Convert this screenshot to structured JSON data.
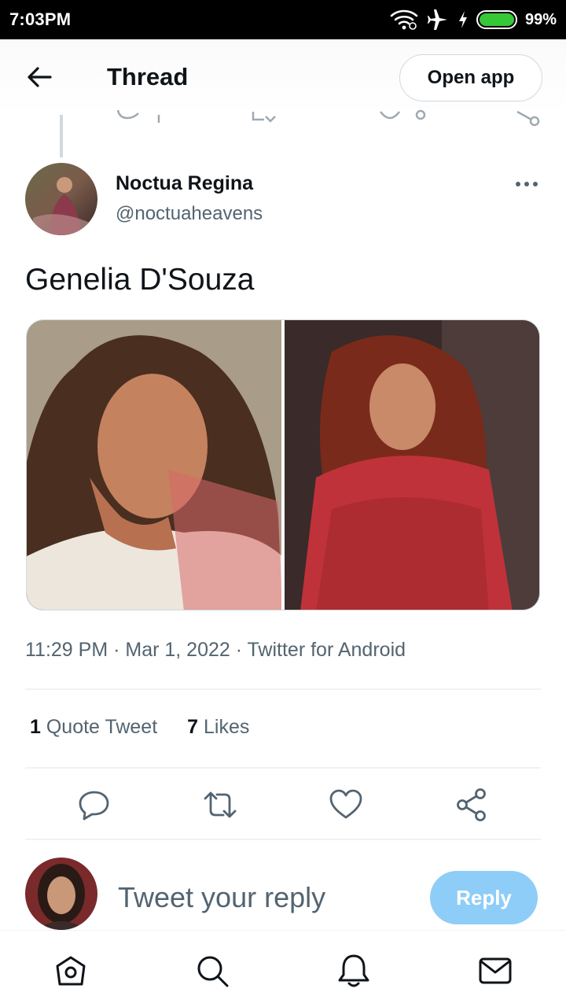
{
  "status_bar": {
    "time": "7:03PM",
    "battery_percent": "99%",
    "battery_level": 0.99,
    "icons": [
      "wifi-icon",
      "airplane-mode-icon",
      "charging-bolt-icon",
      "battery-icon"
    ]
  },
  "header": {
    "title": "Thread",
    "open_app_label": "Open app"
  },
  "tweet": {
    "author_name": "Noctua Regina",
    "author_handle": "@noctuaheavens",
    "text": "Genelia D'Souza",
    "meta": "11:29 PM · Mar 1, 2022 · Twitter for Android",
    "quote_count": "1",
    "quote_label": "Quote Tweet",
    "likes_count": "7",
    "likes_label": "Likes"
  },
  "reply_box": {
    "placeholder": "Tweet your reply",
    "button_label": "Reply"
  },
  "colors": {
    "accent": "#1d9bf0",
    "reply_button_disabled": "#8ecdf7",
    "muted_text": "#536471",
    "border": "#cfd9de",
    "battery_green": "#37c837"
  },
  "bottom_nav": {
    "icons": [
      "home-icon",
      "search-icon",
      "notifications-icon",
      "messages-icon"
    ]
  }
}
